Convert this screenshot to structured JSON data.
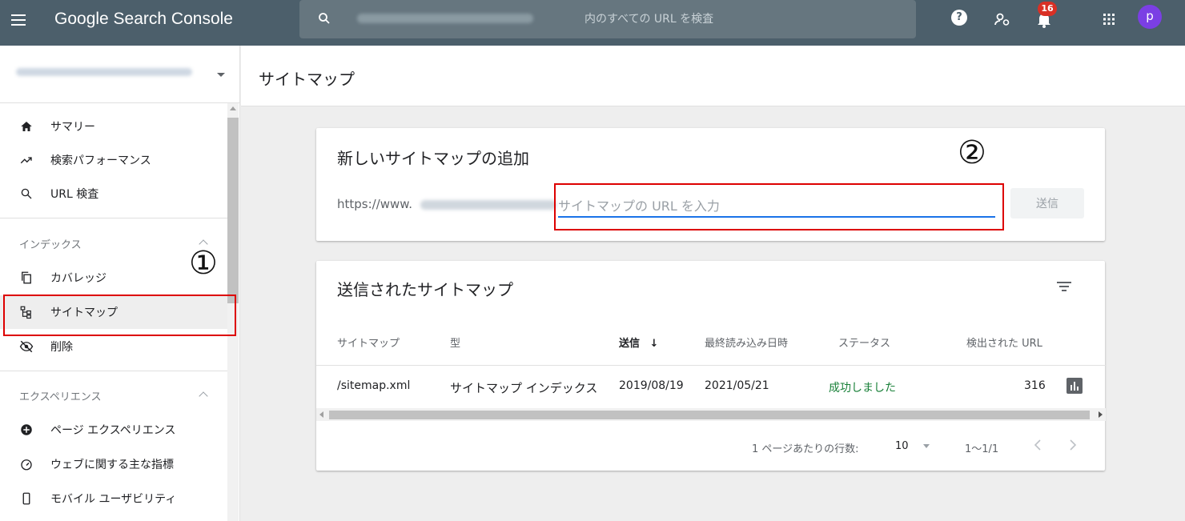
{
  "app": {
    "title": "Google Search Console"
  },
  "search": {
    "placeholder": "内のすべての URL を検査"
  },
  "notifications": {
    "count": "16"
  },
  "user": {
    "initial": "p"
  },
  "page": {
    "title": "サイトマップ"
  },
  "sidebar": {
    "items": [
      {
        "label": "サマリー",
        "icon": "home-icon"
      },
      {
        "label": "検索パフォーマンス",
        "icon": "trending-icon"
      },
      {
        "label": "URL 検査",
        "icon": "search-icon"
      }
    ],
    "index_section": {
      "heading": "インデックス",
      "items": [
        {
          "label": "カバレッジ",
          "icon": "copy-icon"
        },
        {
          "label": "サイトマップ",
          "icon": "sitemap-icon"
        },
        {
          "label": "削除",
          "icon": "visibility-off-icon"
        }
      ]
    },
    "experience_section": {
      "heading": "エクスペリエンス",
      "items": [
        {
          "label": "ページ エクスペリエンス",
          "icon": "add-circle-icon"
        },
        {
          "label": "ウェブに関する主な指標",
          "icon": "speed-icon"
        },
        {
          "label": "モバイル ユーザビリティ",
          "icon": "phone-icon"
        }
      ]
    }
  },
  "annotations": {
    "one": "①",
    "two": "②"
  },
  "add_card": {
    "title": "新しいサイトマップの追加",
    "url_prefix": "https://www.",
    "input_placeholder": "サイトマップの URL を入力",
    "submit_label": "送信"
  },
  "submitted_card": {
    "title": "送信されたサイトマップ",
    "columns": [
      "サイトマップ",
      "型",
      "送信",
      "最終読み込み日時",
      "ステータス",
      "検出された URL"
    ],
    "sort_arrow": "↓",
    "rows": [
      {
        "sitemap": "/sitemap.xml",
        "type": "サイトマップ インデックス",
        "submitted": "2019/08/19",
        "last_read": "2021/05/21",
        "status": "成功しました",
        "urls": "316"
      }
    ],
    "pager": {
      "rows_per_page_label": "1 ページあたりの行数:",
      "rows_per_page": "10",
      "range": "1～1/1"
    }
  },
  "colors": {
    "topbar": "#4c5f6b",
    "accent": "#1a73e8",
    "success": "#188038",
    "annotation": "#dd0000"
  }
}
